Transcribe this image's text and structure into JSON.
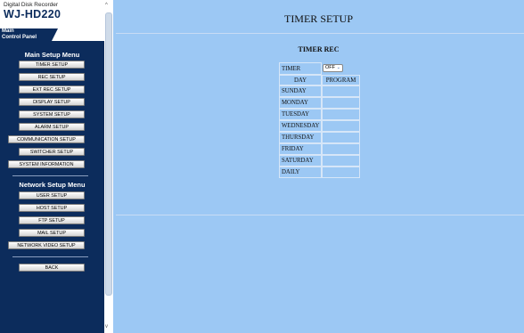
{
  "window": {
    "subtitle": "Digital Disk Recorder",
    "model": "WJ-HD220"
  },
  "control_tab": {
    "label": "Main\nControl Panel"
  },
  "sidebar": {
    "main_title": "Main Setup Menu",
    "main_items": [
      {
        "label": "TIMER SETUP"
      },
      {
        "label": "REC SETUP"
      },
      {
        "label": "EXT REC SETUP"
      },
      {
        "label": "DISPLAY SETUP"
      },
      {
        "label": "SYSTEM SETUP"
      },
      {
        "label": "ALARM SETUP"
      },
      {
        "label": "COMMUNICATION SETUP"
      },
      {
        "label": "SWITCHER SETUP"
      },
      {
        "label": "SYSTEM INFORMATION"
      }
    ],
    "network_title": "Network Setup Menu",
    "network_items": [
      {
        "label": "USER SETUP"
      },
      {
        "label": "HOST SETUP"
      },
      {
        "label": "FTP SETUP"
      },
      {
        "label": "MAIL SETUP"
      },
      {
        "label": "NETWORK VIDEO SETUP"
      }
    ],
    "back_label": "BACK",
    "scroll_up": "^",
    "scroll_down": "v"
  },
  "main": {
    "title": "TIMER SETUP",
    "section": "TIMER REC",
    "timer_label": "TIMER",
    "timer_value": "OFF",
    "timer_arrow": "⌄",
    "headers": {
      "day": "DAY",
      "program": "PROGRAM"
    },
    "days": [
      {
        "name": "SUNDAY",
        "program": ""
      },
      {
        "name": "MONDAY",
        "program": ""
      },
      {
        "name": "TUESDAY",
        "program": ""
      },
      {
        "name": "WEDNESDAY",
        "program": ""
      },
      {
        "name": "THURSDAY",
        "program": ""
      },
      {
        "name": "FRIDAY",
        "program": ""
      },
      {
        "name": "SATURDAY",
        "program": ""
      },
      {
        "name": "DAILY",
        "program": ""
      }
    ]
  },
  "colors": {
    "sidebar": "#0c2c5c",
    "background": "#9cc8f4"
  }
}
